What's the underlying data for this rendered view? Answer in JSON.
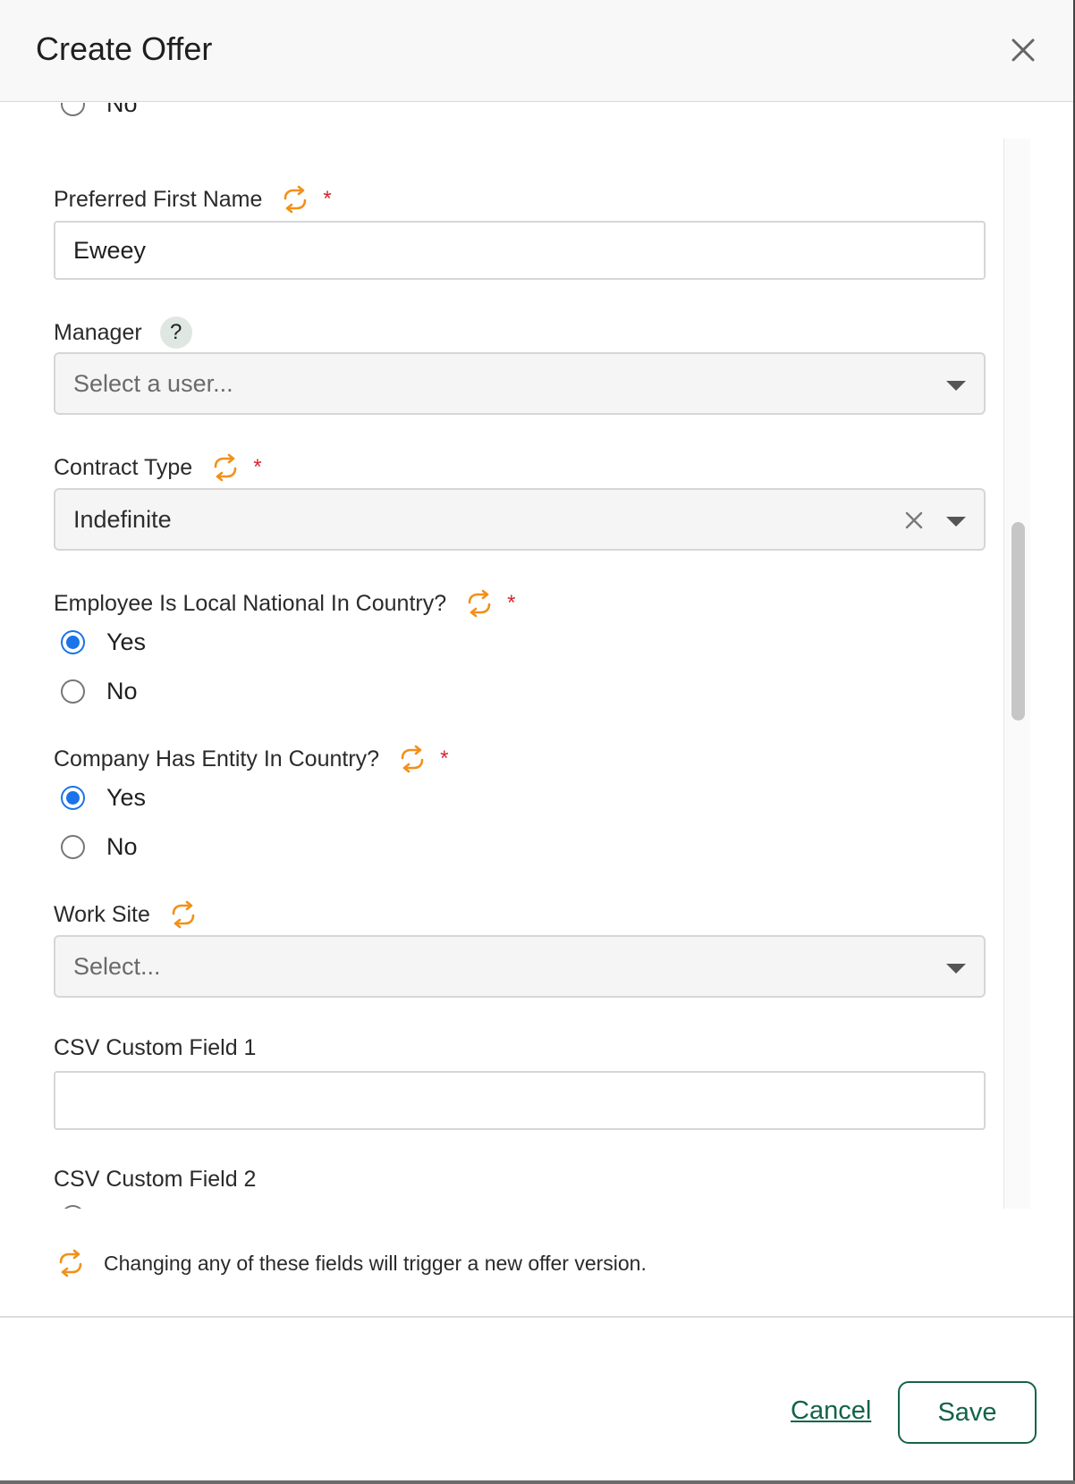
{
  "dialog": {
    "title": "Create Offer",
    "close_icon": "close-icon"
  },
  "fields": {
    "prev_radio_cut": {
      "label": "No"
    },
    "preferred_first_name": {
      "label": "Preferred First Name",
      "value": "Eweey",
      "required": "*"
    },
    "manager": {
      "label": "Manager",
      "help": "?",
      "placeholder": "Select a user..."
    },
    "contract_type": {
      "label": "Contract Type",
      "value": "Indefinite",
      "required": "*"
    },
    "local_national": {
      "label": "Employee Is Local National In Country?",
      "required": "*",
      "options": [
        "Yes",
        "No"
      ],
      "selected": "Yes"
    },
    "company_entity": {
      "label": "Company Has Entity In Country?",
      "required": "*",
      "options": [
        "Yes",
        "No"
      ],
      "selected": "Yes"
    },
    "work_site": {
      "label": "Work Site",
      "placeholder": "Select..."
    },
    "csv_custom_1": {
      "label": "CSV Custom Field 1",
      "value": ""
    },
    "csv_custom_2": {
      "label": "CSV Custom Field 2"
    }
  },
  "footer": {
    "note": "Changing any of these fields will trigger a new offer version.",
    "cancel_label": "Cancel",
    "save_label": "Save"
  },
  "colors": {
    "accent_green": "#146348",
    "sync_orange": "#f2901a",
    "required_red": "#d3262d",
    "radio_blue": "#1a73e8"
  }
}
